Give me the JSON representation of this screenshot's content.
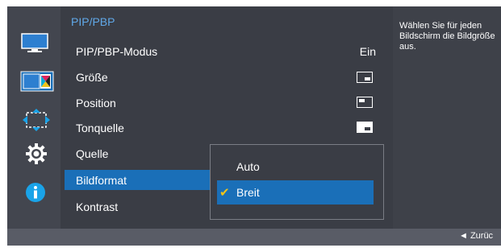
{
  "menu": {
    "title": "PIP/PBP",
    "items": [
      {
        "label": "PIP/PBP-Modus",
        "value": "Ein"
      },
      {
        "label": "Größe"
      },
      {
        "label": "Position"
      },
      {
        "label": "Tonquelle"
      },
      {
        "label": "Quelle"
      },
      {
        "label": "Bildformat"
      },
      {
        "label": "Kontrast"
      }
    ]
  },
  "dropdown": {
    "options": [
      "Auto",
      "Breit"
    ],
    "selected": "Breit"
  },
  "help": {
    "text": "Wählen Sie für jeden Bildschirm die Bildgröße aus."
  },
  "footer": {
    "back_label": "◄ Zurüc"
  },
  "nav_icons": [
    "monitor-icon",
    "picture-color-icon",
    "resize-arrows-icon",
    "settings-gear-icon",
    "info-icon"
  ],
  "colors": {
    "accent": "#1a6fb8",
    "title": "#60a8e8",
    "check": "#f0c419"
  }
}
